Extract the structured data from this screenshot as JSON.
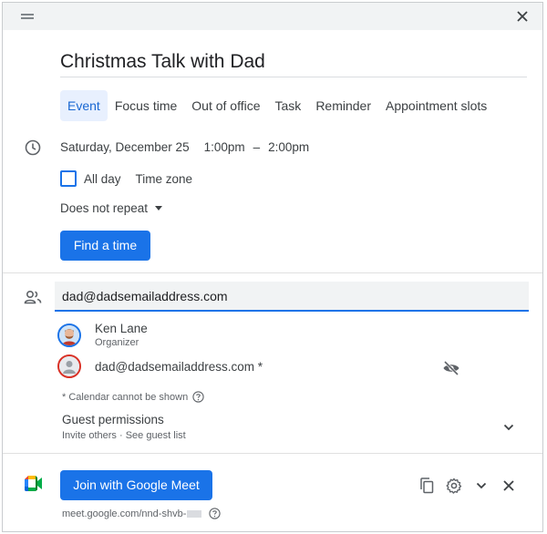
{
  "event": {
    "title": "Christmas Talk with Dad"
  },
  "tabs": [
    "Event",
    "Focus time",
    "Out of office",
    "Task",
    "Reminder",
    "Appointment slots"
  ],
  "active_tab": "Event",
  "datetime": {
    "date": "Saturday, December 25",
    "start": "1:00pm",
    "separator": "–",
    "end": "2:00pm"
  },
  "all_day_label": "All day",
  "time_zone_label": "Time zone",
  "repeat_label": "Does not repeat",
  "find_time_label": "Find a time",
  "guests": {
    "input_value": "dad@dadsemailaddress.com",
    "list": [
      {
        "name": "Ken Lane",
        "role": "Organizer"
      },
      {
        "name": "dad@dadsemailaddress.com *",
        "role": ""
      }
    ],
    "calendar_note": "* Calendar cannot be shown"
  },
  "permissions": {
    "label": "Guest permissions",
    "sub": "Invite others · See guest list"
  },
  "meet": {
    "join_label": "Join with Google Meet",
    "link": "meet.google.com/nnd-shvb-"
  },
  "colors": {
    "accent": "#1a73e8",
    "tab_active_bg": "#e8f0fe",
    "error_ring": "#d93025"
  },
  "icons": [
    "drag-handle-icon",
    "close-icon",
    "clock-icon",
    "people-icon",
    "eye-off-icon",
    "help-icon",
    "chevron-down-icon",
    "google-meet-icon",
    "copy-icon",
    "gear-icon"
  ]
}
